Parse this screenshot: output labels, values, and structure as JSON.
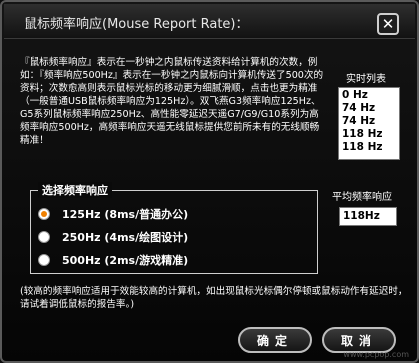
{
  "window": {
    "title": "鼠标频率响应(Mouse Report Rate)：",
    "close_glyph": "✕"
  },
  "description": "『鼠标频率响应』表示在一秒钟之内鼠标传送资料给计算机的次数，例如：『频率响应500Hz』表示在一秒钟之内鼠标向计算机传送了500次的资料；次数愈高则表示鼠标光标的移动更为细腻滑顺，点击也更为精准（一般普通USB鼠标频率响应为125Hz）。双飞燕G3频率响应125Hz、G5系列鼠标频率响应250Hz、高性能零延迟天遥G7/G9/G10系列为高频率响应500Hz，高频率响应天遥无线鼠标提供您前所未有的无线顺畅精准！",
  "realtime_list": {
    "label": "实时列表",
    "items": [
      "0 Hz",
      "74 Hz",
      "74 Hz",
      "118 Hz",
      "118 Hz"
    ]
  },
  "rate_group": {
    "title": "选择频率响应",
    "options": [
      {
        "label": "125Hz (8ms/普通办公)",
        "selected": true
      },
      {
        "label": "250Hz (4ms/绘图设计)",
        "selected": false
      },
      {
        "label": "500Hz (2ms/游戏精准)",
        "selected": false
      }
    ]
  },
  "average": {
    "label": "平均频率响应",
    "value": "118Hz"
  },
  "note": "(较高的频率响应适用于效能较高的计算机，如出现鼠标光标偶尔停顿或鼠标动作有延迟时，请试着调低鼠标的报告率。)",
  "buttons": {
    "ok": "确定",
    "cancel": "取消"
  },
  "watermark": "www.pcpop.com",
  "colors": {
    "selected_radio": "#f08000",
    "background": "#0d0d0d"
  }
}
